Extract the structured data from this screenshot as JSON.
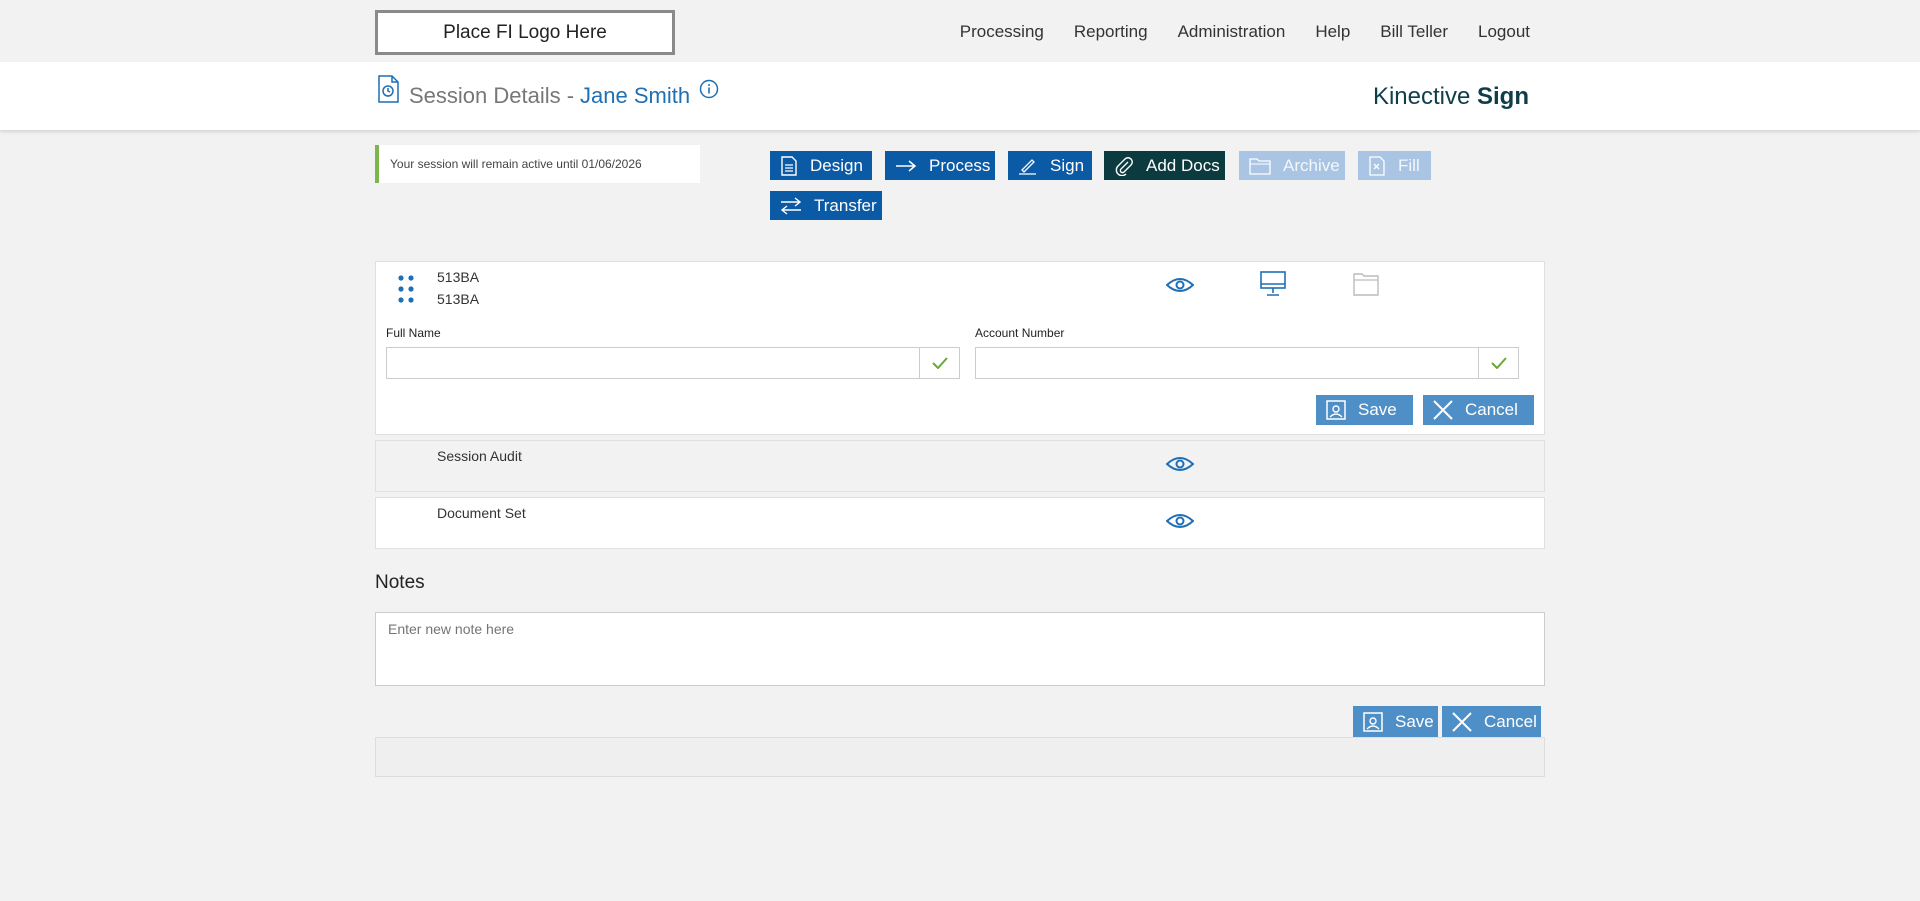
{
  "topbar": {
    "logo_text": "Place FI Logo Here",
    "nav": [
      "Processing",
      "Reporting",
      "Administration",
      "Help",
      "Bill Teller",
      "Logout"
    ]
  },
  "header": {
    "title": "Session Details -",
    "name": "Jane Smith",
    "brand_light": "Kinective",
    "brand_bold": "Sign"
  },
  "session_banner": "Your session will remain active until 01/06/2026",
  "actions": {
    "design": "Design",
    "process": "Process",
    "sign": "Sign",
    "add_docs": "Add Docs",
    "archive": "Archive",
    "fill": "Fill",
    "transfer": "Transfer"
  },
  "document": {
    "line1": "513BA",
    "line2": "513BA",
    "full_name_label": "Full Name",
    "full_name_value": "",
    "account_label": "Account Number",
    "account_value": "",
    "save": "Save",
    "cancel": "Cancel"
  },
  "rows": {
    "session_audit": "Session Audit",
    "document_set": "Document Set"
  },
  "notes": {
    "title": "Notes",
    "placeholder": "Enter new note here",
    "save": "Save",
    "cancel": "Cancel"
  },
  "colors": {
    "primary": "#0b5aa5",
    "dark": "#0c3b3f",
    "disabled": "#a9c5e3",
    "accent_green": "#7ab648"
  }
}
